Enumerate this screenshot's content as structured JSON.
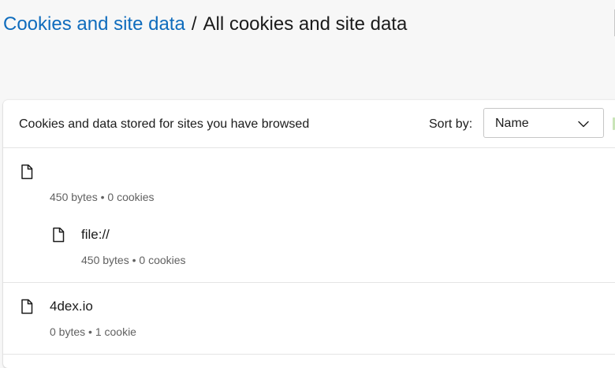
{
  "breadcrumb": {
    "parent": "Cookies and site data",
    "separator": "/",
    "current": "All cookies and site data"
  },
  "list_header": {
    "title": "Cookies and data stored for sites you have browsed",
    "sort_label": "Sort by:",
    "sort_value": "Name"
  },
  "sites": [
    {
      "name": "",
      "size": "450 bytes",
      "bullet": "•",
      "cookies": "0 cookies",
      "children": [
        {
          "name": "file://",
          "size": "450 bytes",
          "bullet": "•",
          "cookies": "0 cookies"
        }
      ]
    },
    {
      "name": "4dex.io",
      "size": "0 bytes",
      "bullet": "•",
      "cookies": "1 cookie",
      "children": []
    }
  ],
  "icons": {
    "site": "file-icon",
    "sort": "chevron-down-icon"
  },
  "colors": {
    "link": "#0f6cbd",
    "background": "#f7f7f7",
    "card": "#ffffff",
    "secondary_text": "#616161"
  }
}
